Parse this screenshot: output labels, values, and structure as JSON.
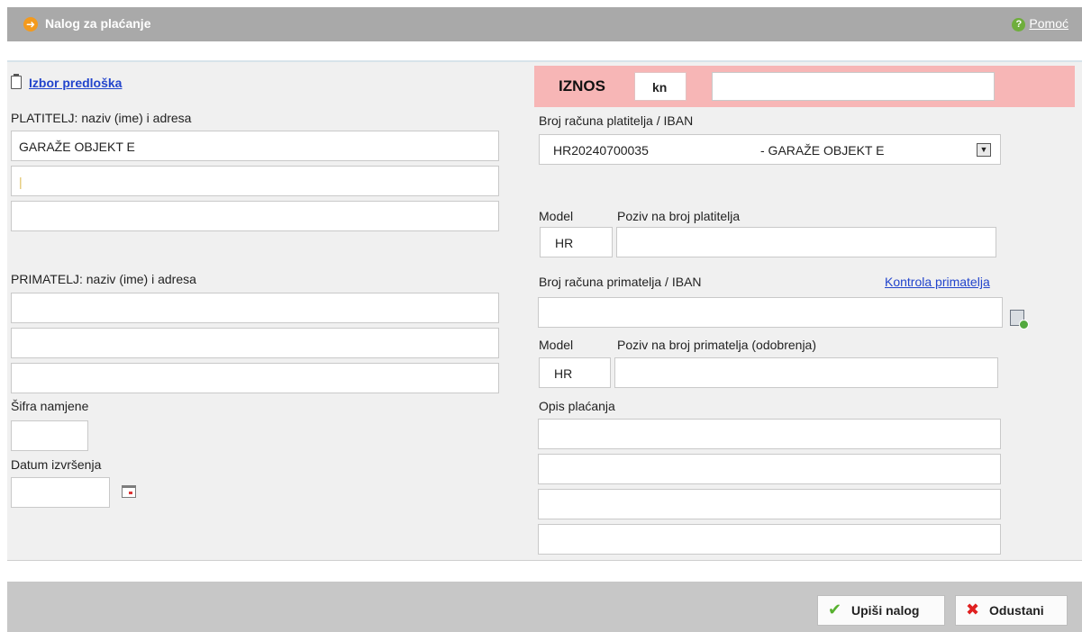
{
  "window": {
    "title": "Nalog za plaćanje",
    "help_label": "Pomoć"
  },
  "form": {
    "template_link": "Izbor predloška",
    "payer": {
      "label": "PLATITELJ: naziv (ime) i adresa",
      "line1": "GARAŽE OBJEKT E",
      "line2": "",
      "line3": ""
    },
    "payee": {
      "label": "PRIMATELJ: naziv (ime) i adresa",
      "line1": "",
      "line2": "",
      "line3": ""
    },
    "purpose_code": {
      "label": "Šifra namjene",
      "value": ""
    },
    "execution_date": {
      "label": "Datum izvršenja",
      "value": ""
    },
    "amount": {
      "label": "IZNOS",
      "currency": "kn",
      "value": ""
    },
    "payer_account": {
      "label": "Broj računa platitelja / IBAN",
      "iban": "HR20240700035",
      "name": "- GARAŽE OBJEKT E"
    },
    "payer_reference": {
      "model_label": "Model",
      "model_value": "HR",
      "label": "Poziv na broj platitelja",
      "value": ""
    },
    "payee_account": {
      "label": "Broj računa primatelja / IBAN",
      "check_link": "Kontrola primatelja",
      "value": ""
    },
    "payee_reference": {
      "model_label": "Model",
      "model_value": "HR",
      "label": "Poziv na broj primatelja (odobrenja)",
      "value": ""
    },
    "description": {
      "label": "Opis plaćanja",
      "line1": "",
      "line2": "",
      "line3": "",
      "line4": ""
    }
  },
  "footer": {
    "submit_label": "Upiši nalog",
    "cancel_label": "Odustani"
  },
  "colors": {
    "title_bar": "#a9a9a9",
    "amount_highlight": "#f7b6b6",
    "link": "#2244cc"
  },
  "icons": [
    "arrow-right-icon",
    "help-icon",
    "clipboard-icon",
    "dropdown-arrow-icon",
    "calculator-add-icon",
    "calendar-icon",
    "checkmark-icon",
    "x-icon"
  ]
}
